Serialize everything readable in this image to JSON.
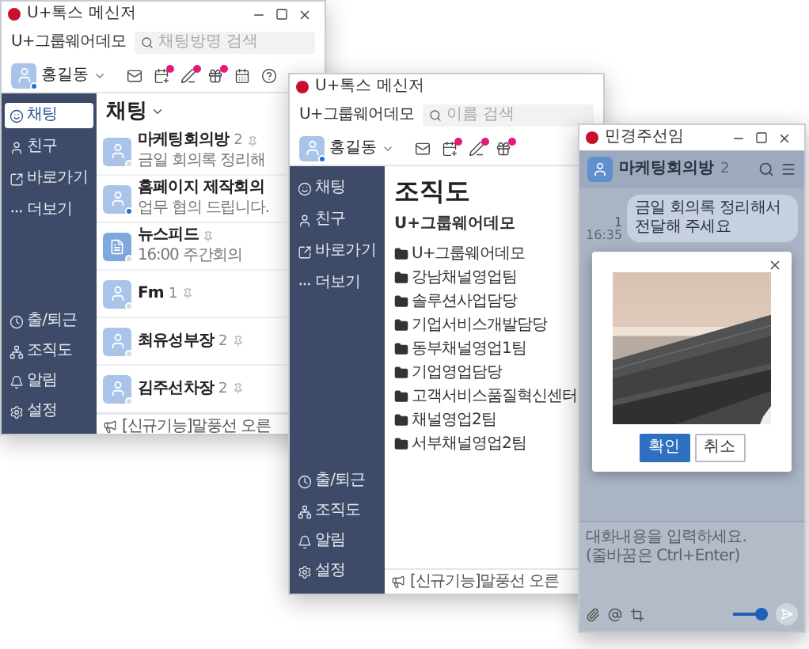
{
  "windows": [
    {
      "kind": "chat-list",
      "title": "U+톡스 메신저",
      "controls": true,
      "company": "U+그룹웨어데모",
      "search": {
        "placeholder": "채팅방명 검색"
      },
      "user": {
        "name": "홍길동",
        "online": true
      },
      "toolbar": [
        {
          "badge": false
        },
        {
          "badge": true
        },
        {
          "badge": true
        },
        {
          "badge": true
        },
        {
          "badge": false
        },
        {
          "badge": false
        }
      ],
      "sidebar": {
        "items": [
          {
            "label": "채팅",
            "selected": true
          },
          {
            "label": "친구",
            "selected": false
          },
          {
            "label": "바로가기",
            "selected": false
          },
          {
            "label": "더보기",
            "selected": false
          }
        ],
        "bottom_items": [
          {
            "label": "출/퇴근",
            "selected": false
          },
          {
            "label": "조직도",
            "selected": false
          },
          {
            "label": "알림",
            "selected": false
          },
          {
            "label": "설정",
            "selected": false
          }
        ]
      },
      "list": {
        "title": "채팅",
        "rooms": [
          {
            "kind": "person",
            "name": "마케팅회의방",
            "count": "2",
            "pinned": true,
            "preview": "금일 회의록 정리해",
            "online": false
          },
          {
            "kind": "person",
            "name": "홈페이지 제작회의",
            "pinned": false,
            "preview": "업무 협의 드립니다.",
            "online": true
          },
          {
            "kind": "feed",
            "name": "뉴스피드",
            "pinned": true,
            "preview": "16:00 주간회의",
            "online": false
          },
          {
            "kind": "person",
            "name": "Fm",
            "count": "1",
            "pinned": true,
            "online": false
          },
          {
            "kind": "person",
            "name": "최유성부장",
            "count": "2",
            "pinned": true,
            "online": false
          },
          {
            "kind": "person",
            "name": "김주선차장",
            "count": "2",
            "pinned": true,
            "online": false
          }
        ]
      },
      "notice": "[신규기능]말풍선 오른"
    },
    {
      "kind": "org-chart",
      "title": "U+톡스 메신저",
      "controls": false,
      "company": "U+그룹웨어데모",
      "search": {
        "placeholder": "이름 검색"
      },
      "user": {
        "name": "홍길동",
        "online": true
      },
      "toolbar": [
        {
          "badge": false
        },
        {
          "badge": true
        },
        {
          "badge": true
        },
        {
          "badge": true
        }
      ],
      "sidebar": {
        "items": [
          {
            "label": "채팅",
            "selected": false
          },
          {
            "label": "친구",
            "selected": false
          },
          {
            "label": "바로가기",
            "selected": false
          },
          {
            "label": "더보기",
            "selected": false
          }
        ],
        "bottom_items": [
          {
            "label": "출/퇴근",
            "selected": false
          },
          {
            "label": "조직도",
            "selected": false
          },
          {
            "label": "알림",
            "selected": false
          },
          {
            "label": "설정",
            "selected": false
          }
        ]
      },
      "org": {
        "title": "조직도",
        "company": "U+그룹웨어데모",
        "departments": [
          "U+그룹웨어데모",
          "강남채널영업팀",
          "솔루션사업담당",
          "기업서비스개발담당",
          "동부채널영업1팀",
          "기업영업담당",
          "고객서비스품질혁신센터",
          "채널영업2팀",
          "서부채널영업2팀"
        ]
      },
      "notice": "[신규기능]말풍선 오른"
    },
    {
      "kind": "chat-room",
      "title": "민경주선임",
      "controls": true,
      "room": {
        "name": "마케팅회의방",
        "count": "2"
      },
      "messages": [
        {
          "unread": "1",
          "time": "16:35",
          "text": "금일 회의록 정리해서 전달해 주세요"
        }
      ],
      "dialog": {
        "buttons": [
          {
            "label": "확인",
            "primary": true
          },
          {
            "label": "취소",
            "primary": false
          }
        ]
      },
      "input": {
        "placeholder": "대화내용을 입력하세요. (줄바꿈은 Ctrl+Enter)"
      },
      "toggle": {
        "on": true
      }
    }
  ]
}
